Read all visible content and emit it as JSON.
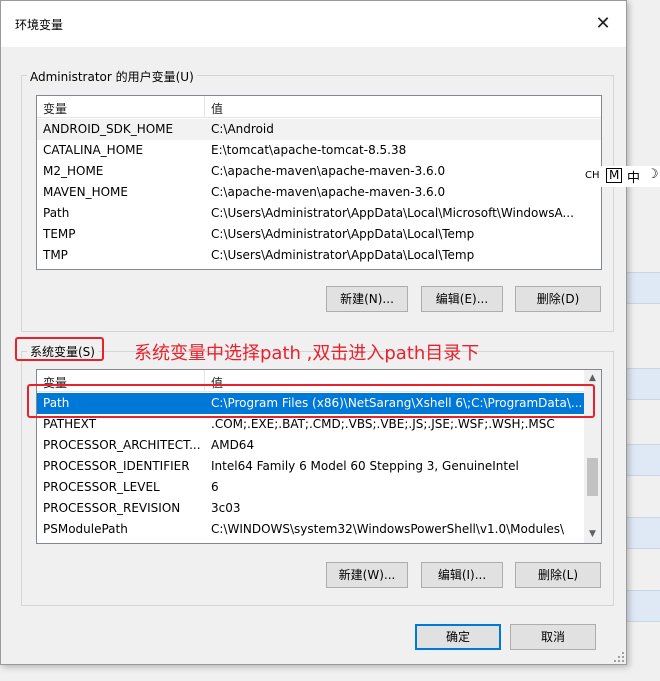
{
  "window": {
    "title": "环境变量",
    "close_glyph": "✕"
  },
  "user_vars": {
    "group_label": "Administrator 的用户变量(U)",
    "columns": [
      "变量",
      "值"
    ],
    "rows": [
      [
        "ANDROID_SDK_HOME",
        "C:\\Android"
      ],
      [
        "CATALINA_HOME",
        "E:\\tomcat\\apache-tomcat-8.5.38"
      ],
      [
        "M2_HOME",
        "C:\\apache-maven\\apache-maven-3.6.0"
      ],
      [
        "MAVEN_HOME",
        "C:\\apache-maven\\apache-maven-3.6.0"
      ],
      [
        "Path",
        "C:\\Users\\Administrator\\AppData\\Local\\Microsoft\\WindowsA..."
      ],
      [
        "TEMP",
        "C:\\Users\\Administrator\\AppData\\Local\\Temp"
      ],
      [
        "TMP",
        "C:\\Users\\Administrator\\AppData\\Local\\Temp"
      ]
    ],
    "buttons": {
      "new": "新建(N)...",
      "edit": "编辑(E)...",
      "delete": "删除(D)"
    }
  },
  "system_vars": {
    "group_label": "系统变量(S)",
    "columns": [
      "变量",
      "值"
    ],
    "rows": [
      [
        "Path",
        "C:\\Program Files (x86)\\NetSarang\\Xshell 6\\;C:\\ProgramData\\..."
      ],
      [
        "PATHEXT",
        ".COM;.EXE;.BAT;.CMD;.VBS;.VBE;.JS;.JSE;.WSF;.WSH;.MSC"
      ],
      [
        "PROCESSOR_ARCHITECT...",
        "AMD64"
      ],
      [
        "PROCESSOR_IDENTIFIER",
        "Intel64 Family 6 Model 60 Stepping 3, GenuineIntel"
      ],
      [
        "PROCESSOR_LEVEL",
        "6"
      ],
      [
        "PROCESSOR_REVISION",
        "3c03"
      ],
      [
        "PSModulePath",
        "C:\\WINDOWS\\system32\\WindowsPowerShell\\v1.0\\Modules\\"
      ]
    ],
    "selected_index": 0,
    "buttons": {
      "new": "新建(W)...",
      "edit": "编辑(I)...",
      "delete": "删除(L)"
    }
  },
  "footer": {
    "ok": "确定",
    "cancel": "取消"
  },
  "annotation": {
    "text": "系统变量中选择path ,双击进入path目录下",
    "color": "#e8212d"
  },
  "ime": {
    "mode": "CH",
    "m": "M",
    "zh": "中",
    "moon": "☽"
  },
  "colors": {
    "selection": "#0078d7",
    "accent_border": "#0078d7"
  }
}
